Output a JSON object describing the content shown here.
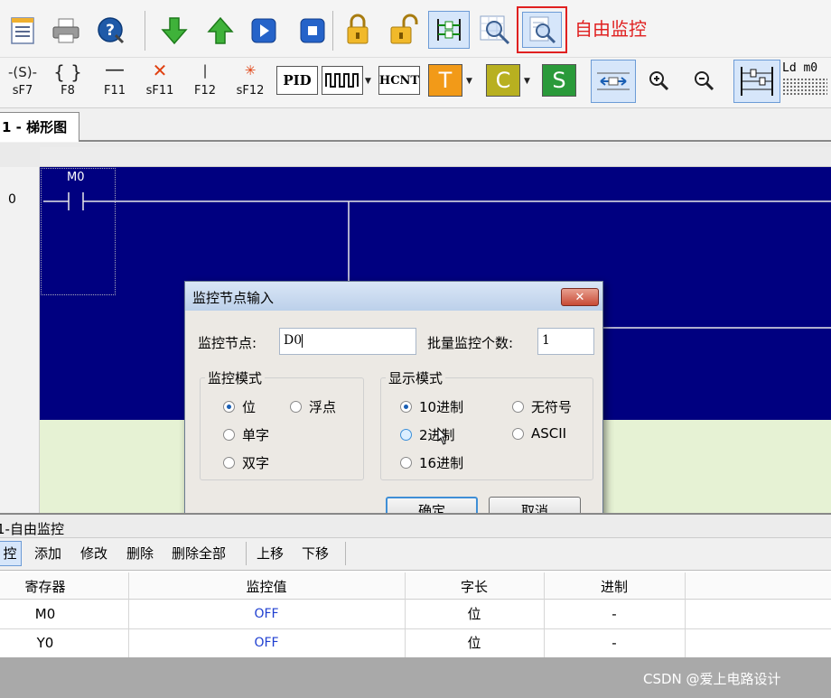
{
  "annotation": {
    "free_monitor": "自由监控"
  },
  "toolbar1": {
    "icons": [
      "list-icon",
      "printer-icon",
      "help-icon",
      "download-icon",
      "upload-icon",
      "run-icon",
      "stop-icon",
      "lock-icon",
      "unlock-icon",
      "ladder-monitor-icon",
      "monitor-grid-icon",
      "free-monitor-icon"
    ]
  },
  "toolbar2": {
    "items": [
      {
        "symbol": "-(S)-",
        "key": "sF7"
      },
      {
        "symbol": "{ }",
        "key": "F8"
      },
      {
        "symbol": "—",
        "key": "F11"
      },
      {
        "symbol": "✕",
        "key": "sF11"
      },
      {
        "symbol": "|",
        "key": "F12"
      },
      {
        "symbol": "✳",
        "key": "sF12"
      }
    ],
    "pid": "PID",
    "hcnt": "HCNT",
    "t": "T",
    "c": "C",
    "s": "S",
    "ldm0": "Ld m0"
  },
  "tab": {
    "label": "1 - 梯形图"
  },
  "ladder": {
    "row_number": "0",
    "contact_label": "M0"
  },
  "dialog": {
    "title": "监控节点输入",
    "node_label": "监控节点:",
    "node_value": "D0",
    "batch_label": "批量监控个数:",
    "batch_value": "1",
    "monitor_mode_label": "监控模式",
    "monitor_modes": [
      "位",
      "浮点",
      "单字",
      "双字"
    ],
    "display_mode_label": "显示模式",
    "display_modes": [
      "10进制",
      "无符号",
      "2进制",
      "ASCII",
      "16进制"
    ],
    "ok": "确定",
    "cancel": "取消"
  },
  "monitor_panel": {
    "title": "1-自由监控",
    "toolbar": [
      "控",
      "添加",
      "修改",
      "删除",
      "删除全部",
      "上移",
      "下移"
    ],
    "columns": [
      "寄存器",
      "监控值",
      "字长",
      "进制"
    ],
    "rows": [
      {
        "register": "M0",
        "value": "OFF",
        "length": "位",
        "base": "-"
      },
      {
        "register": "Y0",
        "value": "OFF",
        "length": "位",
        "base": "-"
      }
    ]
  },
  "watermark": "CSDN @爱上电路设计",
  "colors": {
    "ladder_bg": "#000080",
    "dialog_title": "#c9daf0",
    "highlight": "#e02020",
    "value_text": "#1f3fd0"
  }
}
